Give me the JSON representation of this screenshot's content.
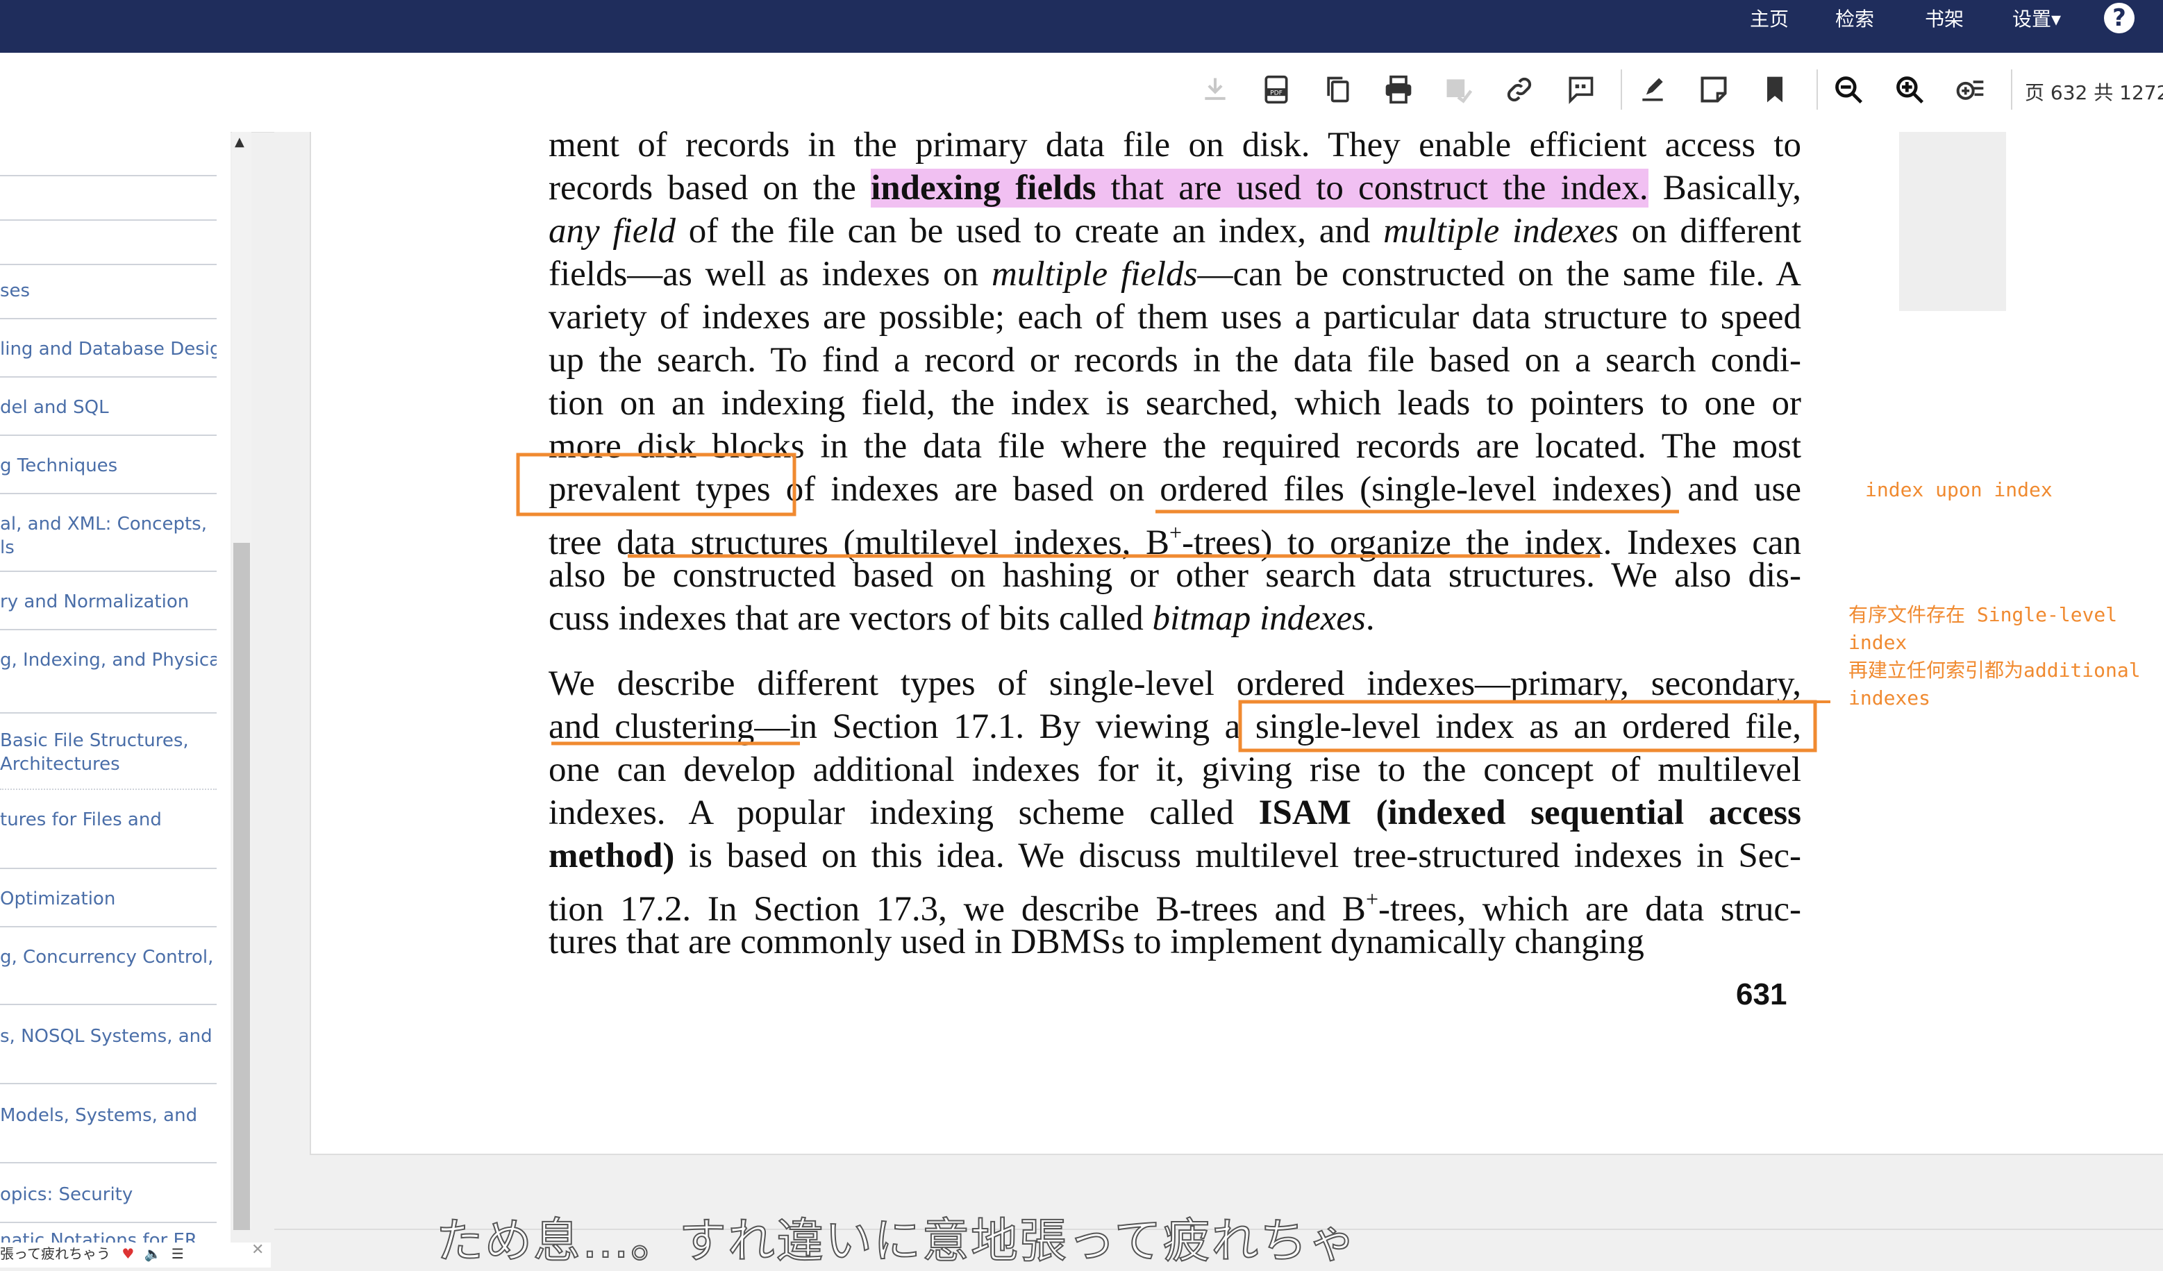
{
  "topnav": {
    "home": "主页",
    "search": "检索",
    "bookshelf": "书架",
    "settings": "设置▾",
    "help": "?"
  },
  "toolbar": {
    "page_info": "页 632 共 1272"
  },
  "sidebar": {
    "items": [
      "",
      "",
      "",
      "ses",
      "ling and Database Design",
      "del and SQL",
      "g Techniques",
      "al, and XML: Concepts,\nls",
      "ry and Normalization",
      "g, Indexing, and Physical",
      "Basic File Structures,\nArchitectures",
      "tures for Files and",
      "Optimization",
      "g, Concurrency Control,",
      "s, NOSQL Systems, and",
      "Models, Systems, and",
      "opics: Security",
      "natic Notations for ER"
    ]
  },
  "document": {
    "lines": [
      [
        "ment of records in the primary data file on disk. They enable efficient access to"
      ],
      [
        "records based on the ",
        {
          "hlb": "indexing fields"
        },
        {
          "hl": " that are used to construct the index."
        },
        " Basically,"
      ],
      [
        {
          "i": "any field"
        },
        " of the file can be used to create an index, and ",
        {
          "i": "multiple indexes"
        },
        " on different"
      ],
      [
        "fields—as well as indexes on ",
        {
          "i": "multiple fields"
        },
        "—can be constructed on the same file. A"
      ],
      [
        "variety of indexes are possible; each of them uses a particular data structure to speed"
      ],
      [
        "up the search. To find a record or records in the data file based on a search condi-"
      ],
      [
        "tion on an indexing field, the index is searched, which leads to pointers to one or"
      ],
      [
        "more disk blocks in the data file where the required records are located. The most"
      ],
      [
        "prevalent types of indexes are based on ordered files (single-level indexes) and use"
      ],
      [
        "tree data structures (multilevel indexes, B",
        {
          "sup": "+"
        },
        "-trees) to organize the index. Indexes can"
      ],
      [
        "also be constructed based on hashing or other search data structures. We also dis-"
      ],
      [
        "cuss indexes that are vectors of bits called ",
        {
          "i": "bitmap indexes"
        },
        "."
      ],
      [
        "We describe different types of single-level ordered indexes—primary, secondary,"
      ],
      [
        "and clustering—in Section 17.1. By viewing a single-level index as an ordered file,"
      ],
      [
        "one can develop additional indexes for it, giving rise to the concept of multilevel"
      ],
      [
        "indexes. A popular indexing scheme called ",
        {
          "b": "ISAM (indexed sequential access"
        }
      ],
      [
        {
          "b": "method)"
        },
        " is based on this idea. We discuss multilevel tree-structured indexes in Sec-"
      ],
      [
        "tion 17.2. In Section 17.3, we describe B-trees and B",
        {
          "sup": "+"
        },
        "-trees, which are data struc-"
      ],
      [
        "tures that are commonly used in DBMSs to implement dynamically changing"
      ]
    ],
    "page_number": "631"
  },
  "annotations": {
    "note1": "index upon index",
    "note2": "有序文件存在 Single-level\nindex\n再建立任何索引都为additional\nindexes",
    "color": "#f08a30",
    "highlight_color": "#f1c0f2"
  },
  "subtitle": "ため息…。すれ違いに意地張って疲れちゃ",
  "bottom_strip": "張って疲れちゃう"
}
